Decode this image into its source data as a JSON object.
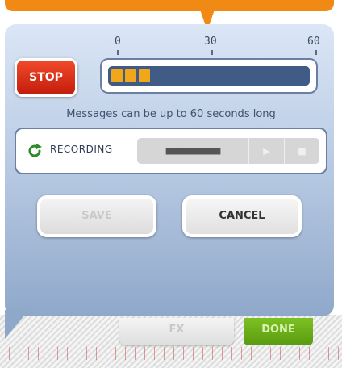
{
  "recorder": {
    "scale_labels": [
      "0",
      "30",
      "60"
    ],
    "stop_label": "STOP",
    "progress_fraction": 0.15,
    "progress_segments": 3,
    "hint": "Messages can be up to 60 seconds long",
    "status_label": "RECORDING",
    "timer_display": "■■■■■■■■■",
    "save_label": "SAVE",
    "cancel_label": "CANCEL"
  },
  "toolbar": {
    "fx_label": "FX",
    "done_label": "DONE"
  },
  "colors": {
    "accent_orange": "#f08a14",
    "stop_red": "#d92a12",
    "meter_fill": "#f2a61a",
    "done_green": "#6aac18",
    "recording_icon_green": "#2f8a2a"
  },
  "icons": {
    "recording": "refresh-icon",
    "play": "play-icon",
    "stop": "stop-square-icon"
  }
}
